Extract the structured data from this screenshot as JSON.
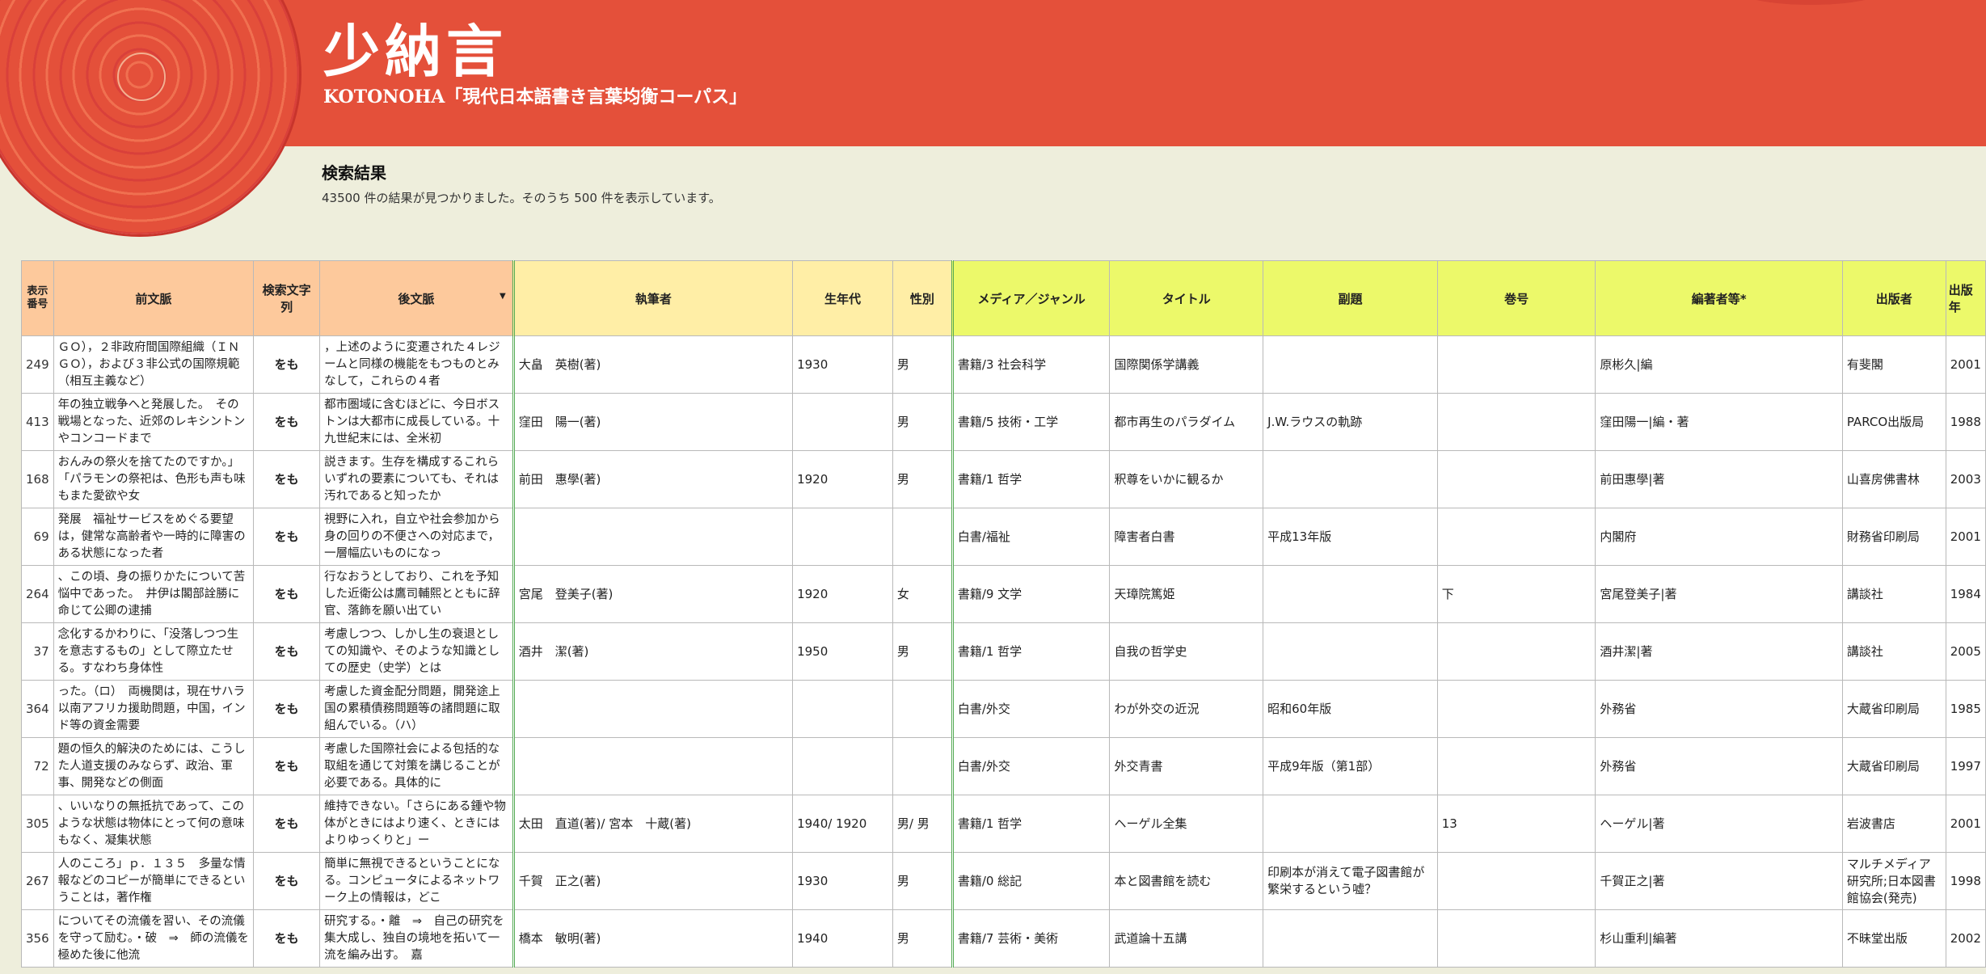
{
  "brand": {
    "title": "少納言",
    "subtitle": "KOTONOHA「現代日本語書き言葉均衡コーパス」"
  },
  "results": {
    "heading": "検索結果",
    "summary": "43500 件の結果が見つかりました。そのうち 500 件を表示しています。"
  },
  "colors": {
    "header_bg": "#e4503a",
    "page_bg": "#eeeedc",
    "context_header": "#fdc99c",
    "author_header": "#ffeea6",
    "media_header": "#ecf96a"
  },
  "table": {
    "headers": {
      "index": "表示番号",
      "before": "前文脈",
      "keyword": "検索文字列",
      "after": "後文脈",
      "author": "執筆者",
      "birth": "生年代",
      "gender": "性別",
      "media": "メディア／ジャンル",
      "title": "タイトル",
      "subtitle": "副題",
      "volume": "巻号",
      "editor": "編著者等*",
      "publisher": "出版者",
      "year": "出版年"
    },
    "rows": [
      {
        "index": "249",
        "before": "ＧＯ），２非政府間国際組織（ＩＮＧＯ），および３非公式の国際規範（相互主義など）",
        "keyword": "をも",
        "after": "，上述のように変遷された４レジームと同様の機能をもつものとみなして，これらの４者",
        "author": "大畠　英樹(著)",
        "birth": "1930",
        "gender": "男",
        "media": "書籍/3 社会科学",
        "title": "国際関係学講義",
        "subtitle": "",
        "volume": "",
        "editor": "原彬久|編",
        "publisher": "有斐閣",
        "year": "2001"
      },
      {
        "index": "413",
        "before": "年の独立戦争へと発展した。　その戦場となった、近郊のレキシントンやコンコードまで",
        "keyword": "をも",
        "after": "都市圏域に含むほどに、今日ボストンは大都市に成長している。十九世紀末には、全米初",
        "author": "窪田　陽一(著)",
        "birth": "",
        "gender": "男",
        "media": "書籍/5 技術・工学",
        "title": "都市再生のパラダイム",
        "subtitle": "J.W.ラウスの軌跡",
        "volume": "",
        "editor": "窪田陽一|編・著",
        "publisher": "PARCO出版局",
        "year": "1988"
      },
      {
        "index": "168",
        "before": "おんみの祭火を捨てたのですか。」　「パラモンの祭祀は、色形も声も味もまた愛欲や女",
        "keyword": "をも",
        "after": "説きます。生存を構成するこれらいずれの要素についても、それは汚れであると知ったか",
        "author": "前田　惠學(著)",
        "birth": "1920",
        "gender": "男",
        "media": "書籍/1 哲学",
        "title": "釈尊をいかに観るか",
        "subtitle": "",
        "volume": "",
        "editor": "前田惠學|著",
        "publisher": "山喜房佛書林",
        "year": "2003"
      },
      {
        "index": "69",
        "before": "発展　福祉サービスをめぐる要望は，健常な高齢者や一時的に障害のある状態になった者",
        "keyword": "をも",
        "after": "視野に入れ，自立や社会参加から身の回りの不便さへの対応まで，一層幅広いものになっ",
        "author": "",
        "birth": "",
        "gender": "",
        "media": "白書/福祉",
        "title": "障害者白書",
        "subtitle": "平成13年版",
        "volume": "",
        "editor": "内閣府",
        "publisher": "財務省印刷局",
        "year": "2001"
      },
      {
        "index": "264",
        "before": "、この頃、身の振りかたについて苦悩中であった。　井伊は閣部詮勝に命じて公卿の逮捕",
        "keyword": "をも",
        "after": "行なおうとしており、これを予知した近衛公は鷹司輔熙とともに辞官、落飾を願い出てい",
        "author": "宮尾　登美子(著)",
        "birth": "1920",
        "gender": "女",
        "media": "書籍/9 文学",
        "title": "天璋院篤姫",
        "subtitle": "",
        "volume": "下",
        "editor": "宮尾登美子|著",
        "publisher": "講談社",
        "year": "1984"
      },
      {
        "index": "37",
        "before": "念化するかわりに、「没落しつつ生を意志するもの」として際立たせる。すなわち身体性",
        "keyword": "をも",
        "after": "考慮しつつ、しかし生の衰退としての知識や、そのような知識としての歴史（史学）とは",
        "author": "酒井　潔(著)",
        "birth": "1950",
        "gender": "男",
        "media": "書籍/1 哲学",
        "title": "自我の哲学史",
        "subtitle": "",
        "volume": "",
        "editor": "酒井潔|著",
        "publisher": "講談社",
        "year": "2005"
      },
      {
        "index": "364",
        "before": "った。（ロ）　両機関は，現在サハラ以南アフリカ援助問題，中国，インド等の資金需要",
        "keyword": "をも",
        "after": "考慮した資金配分問題，開発途上国の累積債務問題等の諸問題に取組んでいる。（ハ）",
        "author": "",
        "birth": "",
        "gender": "",
        "media": "白書/外交",
        "title": "わが外交の近況",
        "subtitle": "昭和60年版",
        "volume": "",
        "editor": "外務省",
        "publisher": "大蔵省印刷局",
        "year": "1985"
      },
      {
        "index": "72",
        "before": "題の恒久的解決のためには、こうした人道支援のみならず、政治、軍事、開発などの側面",
        "keyword": "をも",
        "after": "考慮した国際社会による包括的な取組を通じて対策を講じることが必要である。具体的に",
        "author": "",
        "birth": "",
        "gender": "",
        "media": "白書/外交",
        "title": "外交青書",
        "subtitle": "平成9年版（第1部）",
        "volume": "",
        "editor": "外務省",
        "publisher": "大蔵省印刷局",
        "year": "1997"
      },
      {
        "index": "305",
        "before": "、いいなりの無抵抗であって、このような状態は物体にとって何の意味もなく、凝集状態",
        "keyword": "をも",
        "after": "維持できない。「さらにある鍾や物体がときにはより速く、ときにはよりゆっくりと」ー",
        "author": "太田　直道(著)/ 宮本　十蔵(著)",
        "birth": "1940/ 1920",
        "gender": "男/ 男",
        "media": "書籍/1 哲学",
        "title": "ヘーゲル全集",
        "subtitle": "",
        "volume": "13",
        "editor": "ヘーゲル|著",
        "publisher": "岩波書店",
        "year": "2001"
      },
      {
        "index": "267",
        "before": "人のこころ」ｐ．１３５　多量な情報などのコピーが簡単にできるということは，著作権",
        "keyword": "をも",
        "after": "簡単に無視できるということになる。コンピュータによるネットワーク上の情報は，どこ",
        "author": "千賀　正之(著)",
        "birth": "1930",
        "gender": "男",
        "media": "書籍/0 総記",
        "title": "本と図書館を読む",
        "subtitle": "印刷本が消えて電子図書館が繁栄するという嘘？",
        "volume": "",
        "editor": "千賀正之|著",
        "publisher": "マルチメディア研究所;日本図書館協会(発売)",
        "year": "1998"
      },
      {
        "index": "356",
        "before": "についてその流儀を習い、その流儀を守って励む。・破　⇒　師の流儀を極めた後に他流",
        "keyword": "をも",
        "after": "研究する。・離　⇒　自己の研究を集大成し、独自の境地を拓いて一流を編み出す。　嘉",
        "author": "橋本　敏明(著)",
        "birth": "1940",
        "gender": "男",
        "media": "書籍/7 芸術・美術",
        "title": "武道論十五講",
        "subtitle": "",
        "volume": "",
        "editor": "杉山重利|編著",
        "publisher": "不昧堂出版",
        "year": "2002"
      }
    ]
  }
}
